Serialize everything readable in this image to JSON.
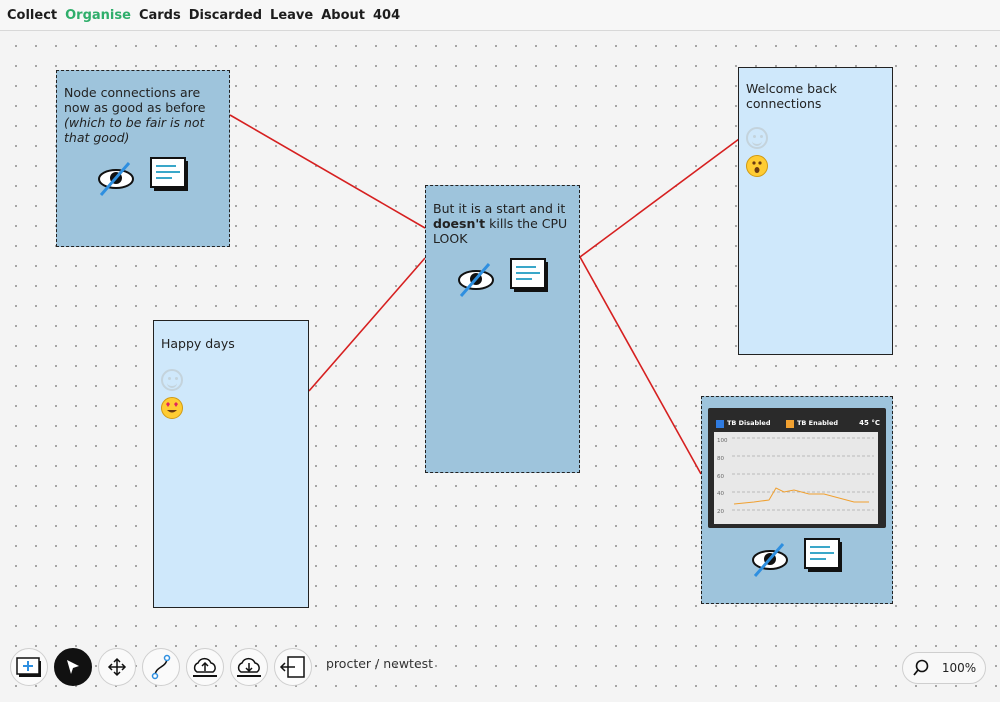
{
  "nav": {
    "items": [
      {
        "label": "Collect"
      },
      {
        "label": "Organise"
      },
      {
        "label": "Cards"
      },
      {
        "label": "Discarded"
      },
      {
        "label": "Leave"
      },
      {
        "label": "About"
      },
      {
        "label": "404"
      }
    ],
    "active": "Organise"
  },
  "cards": {
    "node_connections": {
      "text": "Node connections are now as good as before ",
      "italic": "(which to be fair is not that good)"
    },
    "happy_days": {
      "text": "Happy days"
    },
    "start": {
      "text_before": "But it is a start and it ",
      "bold": "doesn't",
      "text_after": " kills the CPU LOOK"
    },
    "welcome": {
      "text": "Welcome back connections"
    },
    "chart_card": {
      "legend_disabled": "TB Disabled",
      "legend_enabled": "TB Enabled",
      "temperature": "45 °C",
      "y_ticks": [
        "100",
        "80",
        "60",
        "40",
        "20"
      ]
    }
  },
  "toolbar": {
    "breadcrumb": "procter / newtest",
    "zoom": "100%"
  },
  "colors": {
    "accent_nav": "#2fae6b",
    "card_selected": "#9ec4dc",
    "card_plain": "#cfe8fb",
    "link_line": "#d62020"
  },
  "icons": [
    "add-card-icon",
    "pointer-icon",
    "move-icon",
    "connect-icon",
    "upload-cloud-icon",
    "download-cloud-icon",
    "exit-icon",
    "search-icon",
    "hide-icon",
    "text-lines-icon"
  ]
}
